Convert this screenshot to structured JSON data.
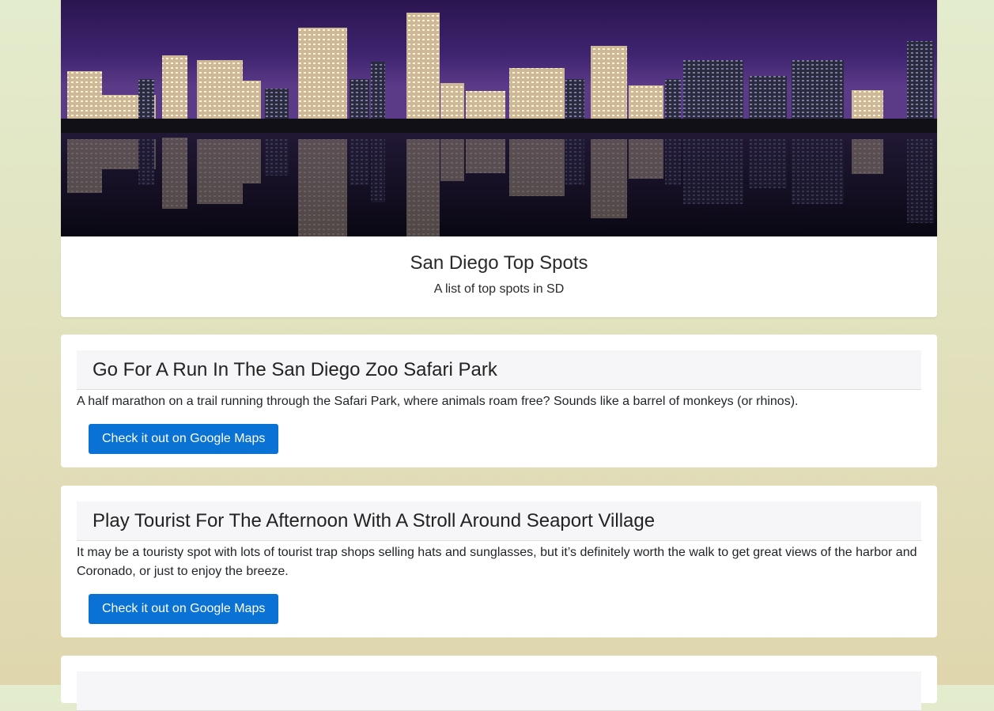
{
  "hero": {
    "image_alt": "San Diego skyline at night reflected on the bay",
    "title": "San Diego Top Spots",
    "subtitle": "A list of top spots in SD"
  },
  "spots": [
    {
      "title": "Go For A Run In The San Diego Zoo Safari Park",
      "description": "A half marathon on a trail running through the Safari Park, where animals roam free? Sounds like a barrel of monkeys (or rhinos).",
      "button_label": "Check it out on Google Maps"
    },
    {
      "title": "Play Tourist For The Afternoon With A Stroll Around Seaport Village",
      "description": "It may be a touristy spot with lots of tourist trap shops selling hats and sunglasses, but it’s definitely worth the walk to get great views of the harbor and Coronado, or just to enjoy the breeze.",
      "button_label": "Check it out on Google Maps"
    },
    {
      "title": "",
      "description": "",
      "button_label": ""
    }
  ],
  "colors": {
    "button_bg": "#0a72d4",
    "card_bg": "#ffffff",
    "header_bg": "#f6f6f8",
    "sky_top": "#2a1550",
    "water": "#0a0a14"
  }
}
